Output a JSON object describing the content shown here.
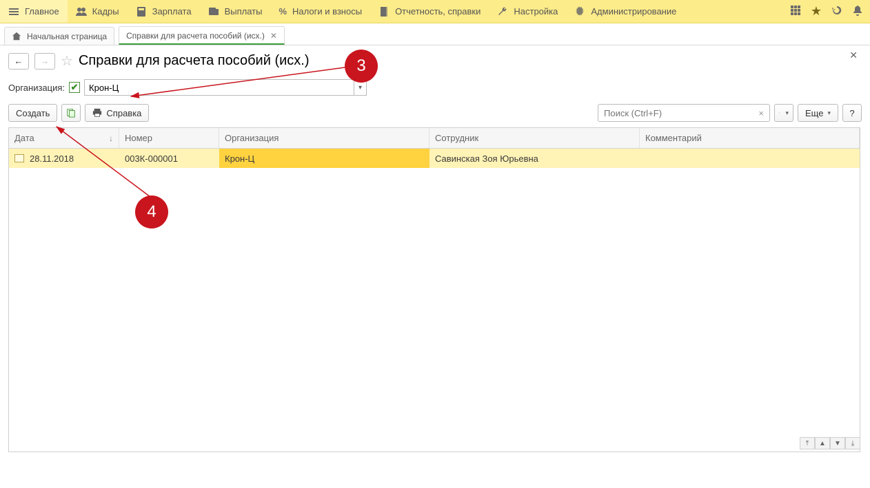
{
  "topbar": {
    "items": [
      {
        "label": "Главное"
      },
      {
        "label": "Кадры"
      },
      {
        "label": "Зарплата"
      },
      {
        "label": "Выплаты"
      },
      {
        "label": "Налоги и взносы"
      },
      {
        "label": "Отчетность, справки"
      },
      {
        "label": "Настройка"
      },
      {
        "label": "Администрирование"
      }
    ]
  },
  "tabs": {
    "home": "Начальная страница",
    "current": "Справки для расчета пособий (исх.)"
  },
  "page": {
    "title": "Справки для расчета пособий (исх.)"
  },
  "filter": {
    "label": "Организация:",
    "value": "Крон-Ц"
  },
  "toolbar": {
    "create": "Создать",
    "help": "Справка",
    "search_placeholder": "Поиск (Ctrl+F)",
    "search_value": "",
    "more": "Еще",
    "question": "?"
  },
  "grid": {
    "columns": {
      "date": "Дата",
      "number": "Номер",
      "org": "Организация",
      "employee": "Сотрудник",
      "comment": "Комментарий"
    },
    "rows": [
      {
        "date": "28.11.2018",
        "number": "003К-000001",
        "org": "Крон-Ц",
        "employee": "Савинская Зоя Юрьевна",
        "comment": ""
      }
    ]
  },
  "callouts": {
    "c3": "3",
    "c4": "4"
  }
}
